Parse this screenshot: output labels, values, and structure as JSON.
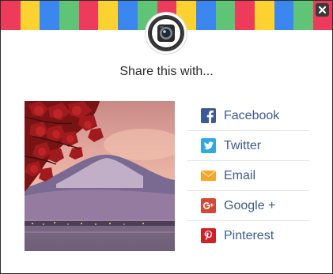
{
  "dialog": {
    "title": "Share this with...",
    "close_label": "×"
  },
  "header": {
    "stripe_colors": [
      "#ee3b5b",
      "#fbd22f",
      "#3c86f0",
      "#5fc476"
    ],
    "badge_icon": "camera-icon"
  },
  "preview": {
    "image": "photo of red maple leaves over misty mountain and lake at sunset"
  },
  "share_options": [
    {
      "label": "Facebook",
      "icon": "facebook-icon",
      "color": "#3b5998"
    },
    {
      "label": "Twitter",
      "icon": "twitter-icon",
      "color": "#2fa9e0"
    },
    {
      "label": "Email",
      "icon": "email-icon",
      "color": "#f6a524"
    },
    {
      "label": "Google +",
      "icon": "google-plus-icon",
      "color": "#d34836"
    },
    {
      "label": "Pinterest",
      "icon": "pinterest-icon",
      "color": "#cc2127"
    }
  ]
}
